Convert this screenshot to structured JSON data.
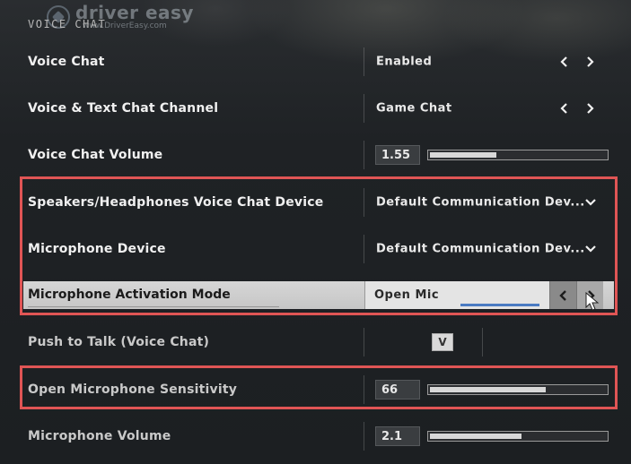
{
  "watermark": {
    "brand": "driver easy",
    "url": "www.DriverEasy.com"
  },
  "section_title": "VOICE CHAT",
  "settings": [
    {
      "label": "Voice Chat",
      "value": "Enabled"
    },
    {
      "label": "Voice & Text Chat Channel",
      "value": "Game Chat"
    },
    {
      "label": "Voice Chat Volume",
      "value": "1.55",
      "level": 0.38
    },
    {
      "label": "Speakers/Headphones Voice Chat Device",
      "value": "Default Communication Dev..."
    },
    {
      "label": "Microphone Device",
      "value": "Default Communication Dev..."
    },
    {
      "label": "Microphone Activation Mode",
      "value": "Open Mic"
    },
    {
      "label": "Push to Talk (Voice Chat)",
      "value": "V"
    },
    {
      "label": "Open Microphone Sensitivity",
      "value": "66",
      "level": 0.66
    },
    {
      "label": "Microphone Volume",
      "value": "2.1",
      "level": 0.52
    }
  ],
  "colors": {
    "highlight": "#e05555",
    "slider_fill": "#d8d8d8",
    "accent_bar": "#4a7bc2"
  }
}
